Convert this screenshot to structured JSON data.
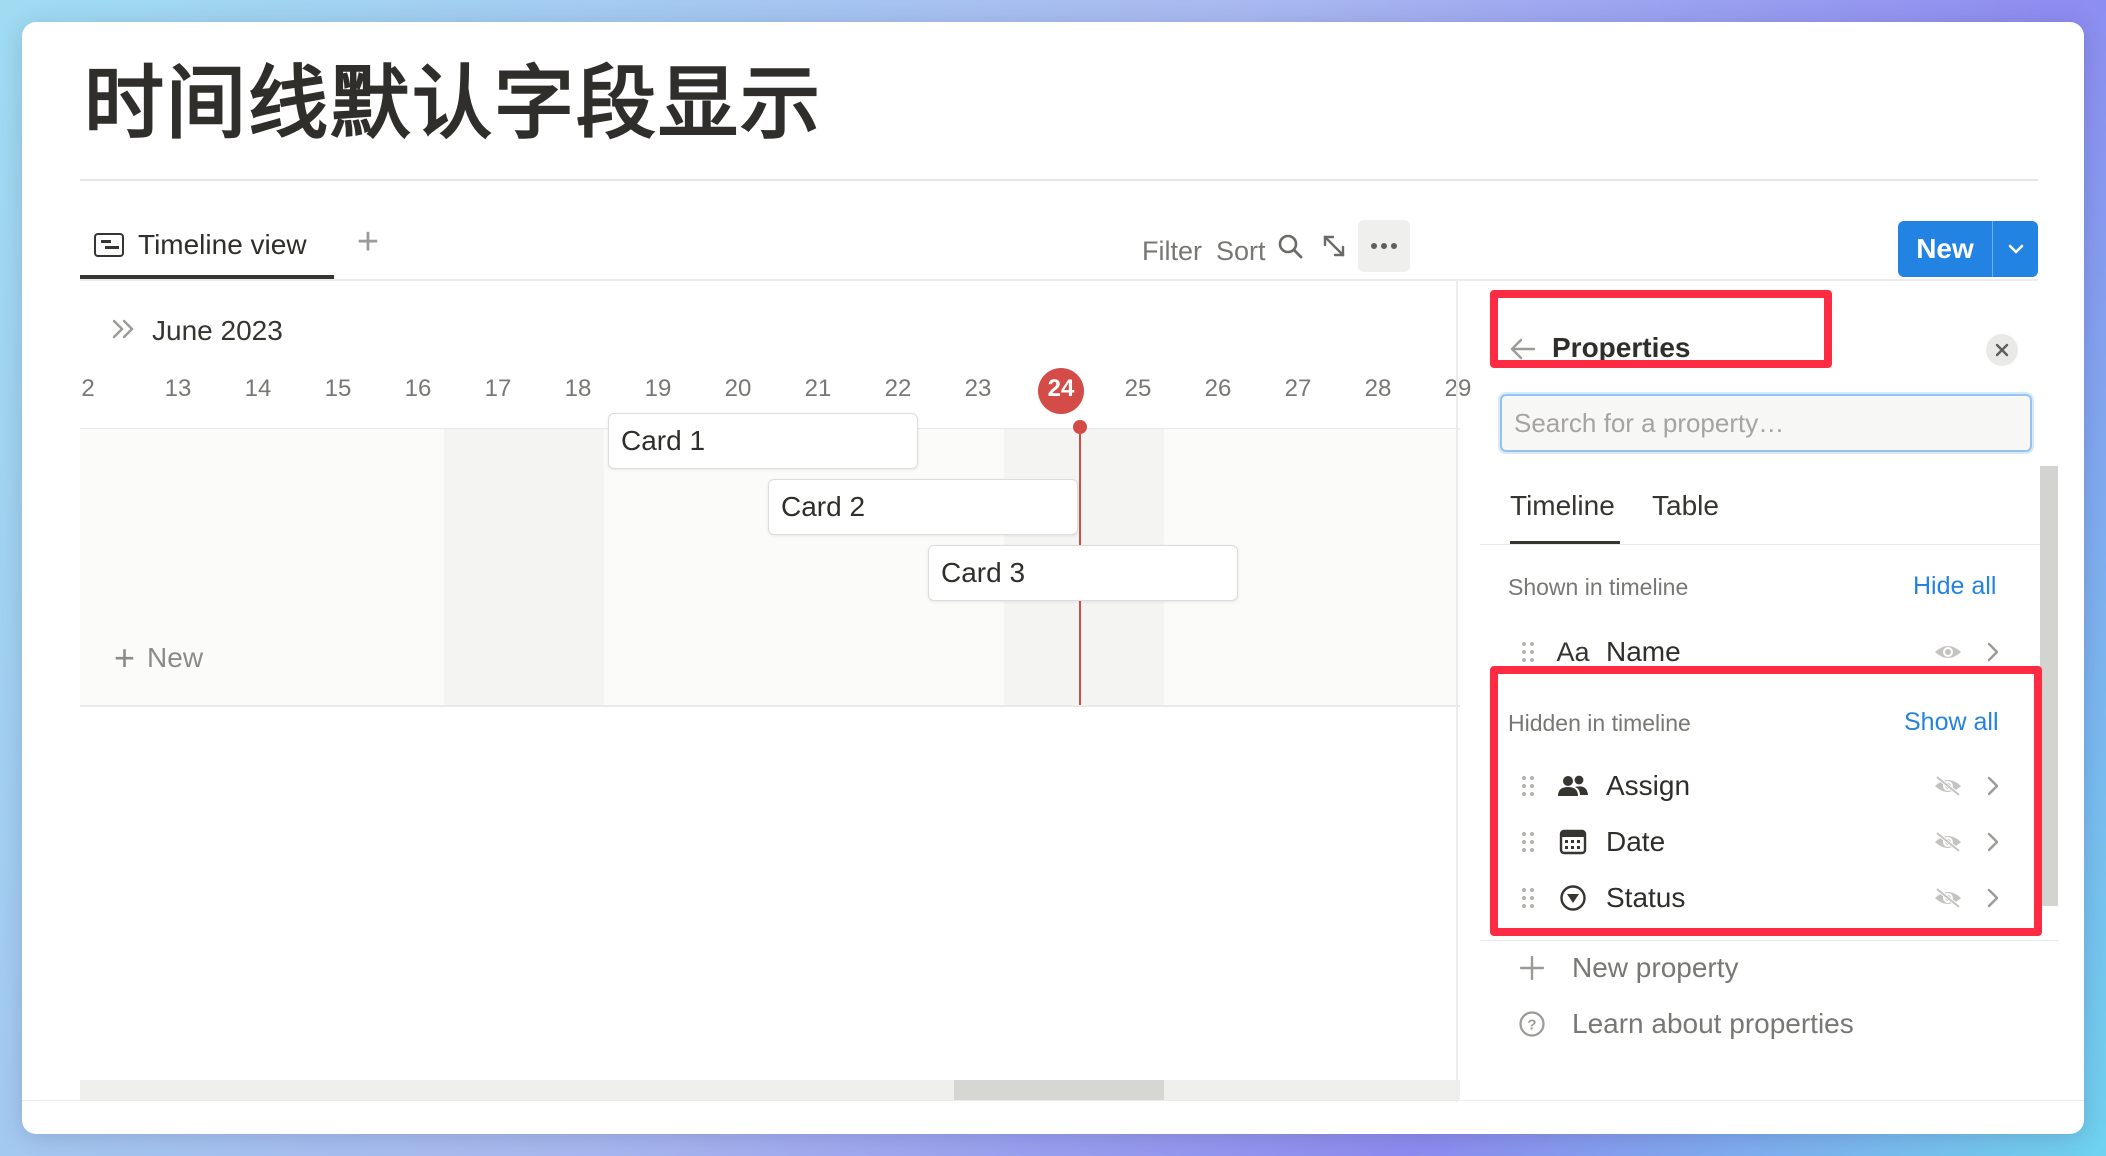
{
  "page": {
    "title": "时间线默认字段显示"
  },
  "views": {
    "active_tab": "Timeline view",
    "add_symbol": "+"
  },
  "toolbar": {
    "filter": "Filter",
    "sort": "Sort",
    "new_label": "New"
  },
  "timeline": {
    "month": "June 2023",
    "days": [
      "2",
      "13",
      "14",
      "15",
      "16",
      "17",
      "18",
      "19",
      "20",
      "21",
      "22",
      "23",
      "24",
      "25",
      "26",
      "27",
      "28",
      "29"
    ],
    "today": "24",
    "cards": [
      "Card 1",
      "Card 2",
      "Card 3"
    ],
    "new_label": "New"
  },
  "panel": {
    "title": "Properties",
    "search_placeholder": "Search for a property…",
    "tabs": [
      "Timeline",
      "Table"
    ],
    "active_tab": "Timeline",
    "shown_section": {
      "label": "Shown in timeline",
      "action": "Hide all"
    },
    "shown_properties": [
      {
        "type_glyph": "Aa",
        "name": "Name",
        "icon": "text-type-icon"
      }
    ],
    "hidden_section": {
      "label": "Hidden in timeline",
      "action": "Show all"
    },
    "hidden_properties": [
      {
        "name": "Assign",
        "icon": "person-icon"
      },
      {
        "name": "Date",
        "icon": "calendar-icon"
      },
      {
        "name": "Status",
        "icon": "status-icon"
      }
    ],
    "footer": {
      "new_property": "New property",
      "learn": "Learn about properties"
    }
  },
  "colors": {
    "accent": "#2383e2",
    "today": "#d44c47",
    "annotation": "#ff2b43"
  }
}
